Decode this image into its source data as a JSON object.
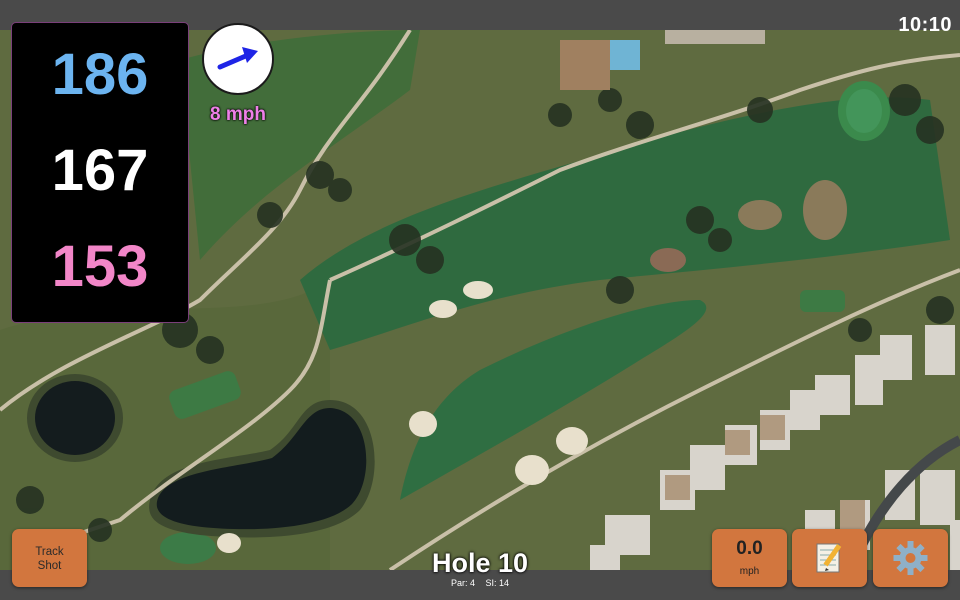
{
  "status": {
    "time": "10:10"
  },
  "yardages": {
    "back": "186",
    "center": "167",
    "front": "153",
    "back_color": "#6cb4f0",
    "center_color": "#ffffff",
    "front_color": "#f286c8"
  },
  "wind": {
    "speed": "8 mph",
    "arrow_color": "#1e24e6",
    "icon": "wind-direction-arrow"
  },
  "hole": {
    "title": "Hole 10",
    "par": "Par: 4",
    "stroke_index": "SI: 14"
  },
  "buttons": {
    "track_shot": {
      "line1": "Track",
      "line2": "Shot"
    },
    "speed": {
      "value": "0.0",
      "unit": "mph"
    },
    "notes_icon": "notepad-pencil-icon",
    "settings_icon": "gear-icon"
  },
  "colors": {
    "button": "#d2763e",
    "bar": "#4a4a4a"
  }
}
